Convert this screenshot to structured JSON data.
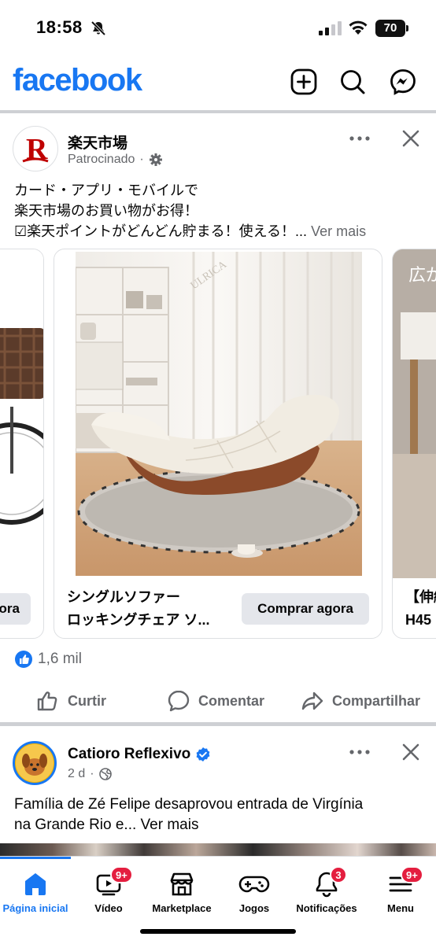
{
  "status_bar": {
    "time": "18:58",
    "battery": "70"
  },
  "header": {
    "logo": "facebook"
  },
  "ad_post": {
    "author": "楽天市場",
    "sponsored": "Patrocinado",
    "text_lines": [
      "カード・アプリ・モバイルで",
      "楽天市場のお買い物がお得！",
      "☑楽天ポイントがどんどん貯まる！使える！..."
    ],
    "see_more": "Ver mais",
    "cards": [
      {
        "title": "",
        "cta": "Comprar agora",
        "cta_visible": "ora"
      },
      {
        "title_line1": "シングルソファー",
        "title_line2": "ロッキングチェア ソ...",
        "cta": "Comprar agora",
        "watermark": "ULRICA"
      },
      {
        "title_line1": "【伸縮",
        "title_line2": "H45",
        "overlay": "広が"
      }
    ],
    "reactions_count": "1,6 mil",
    "actions": {
      "like": "Curtir",
      "comment": "Comentar",
      "share": "Compartilhar"
    }
  },
  "post2": {
    "author": "Catioro Reflexivo",
    "time": "2 d",
    "text_line1": "Família de Zé Felipe desaprovou entrada de Virgínia",
    "text_line2_start": "na Grande Rio e...",
    "see_more": "Ver mais"
  },
  "bottom_nav": [
    {
      "label": "Página inicial",
      "badge": ""
    },
    {
      "label": "Vídeo",
      "badge": "9+"
    },
    {
      "label": "Marketplace",
      "badge": ""
    },
    {
      "label": "Jogos",
      "badge": ""
    },
    {
      "label": "Notificações",
      "badge": "3"
    },
    {
      "label": "Menu",
      "badge": "9+"
    }
  ],
  "colors": {
    "brand": "#1877f2",
    "badge": "#e41e3f",
    "rakuten": "#bf0000"
  }
}
